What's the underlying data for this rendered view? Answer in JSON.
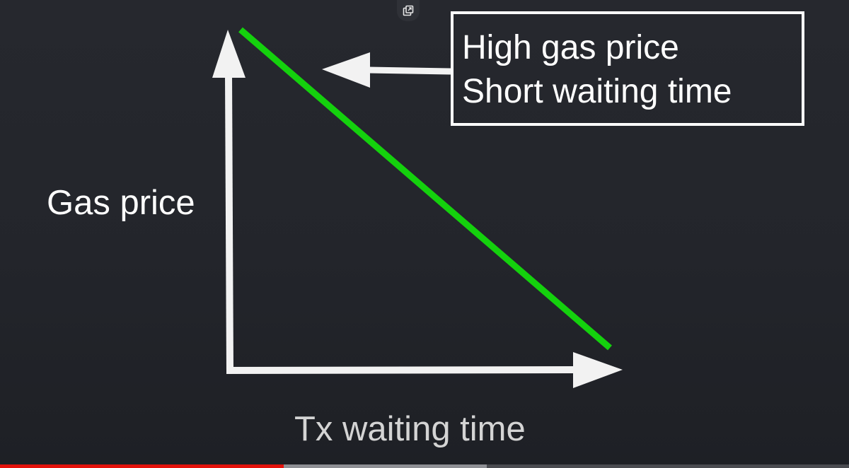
{
  "diagram": {
    "y_axis_label": "Gas price",
    "x_axis_label": "Tx waiting time",
    "callout": {
      "line1": "High gas price",
      "line2": "Short waiting time"
    },
    "trend_line_color": "#14d10d",
    "axis_color": "#f2f2f2"
  },
  "controls": {
    "popout_icon": "picture-in-picture-icon"
  },
  "player": {
    "progress_played": 0.334,
    "progress_buffered": 0.573,
    "played_color": "#e3120b",
    "buffered_color": "#8e8f94"
  }
}
